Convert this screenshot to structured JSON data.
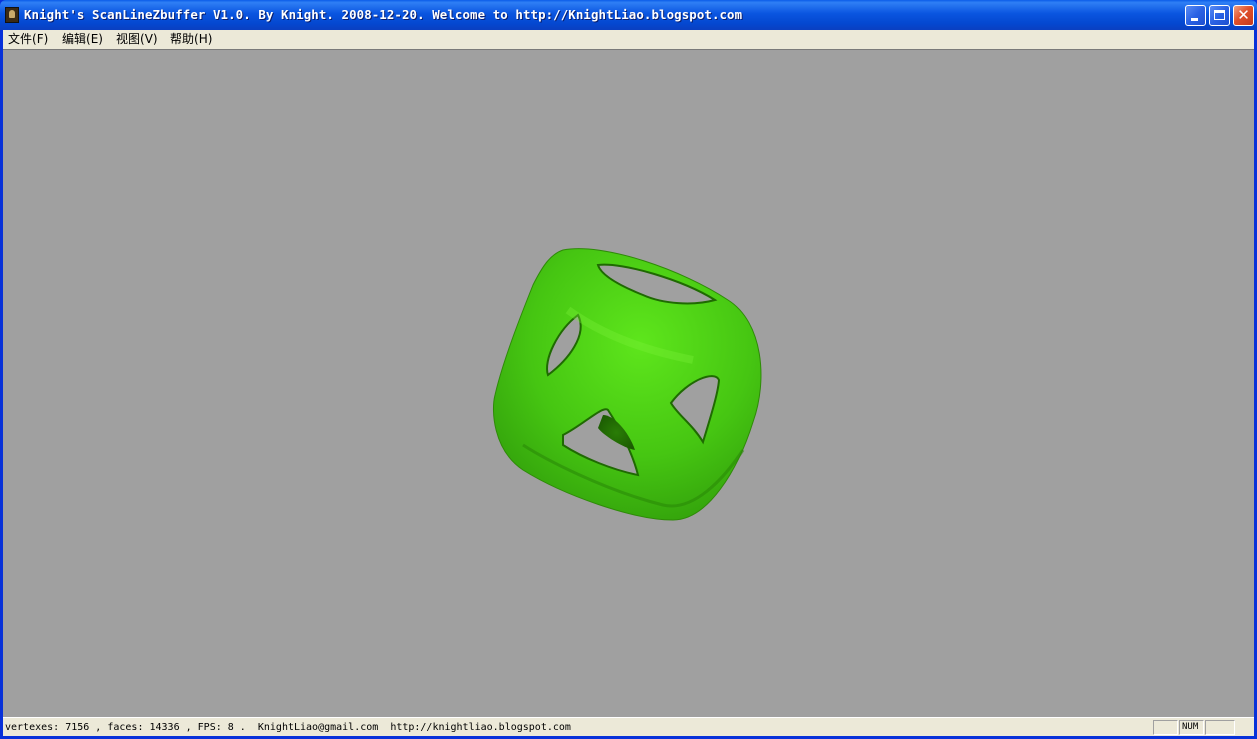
{
  "window": {
    "title": "Knight's ScanLineZbuffer V1.0. By Knight. 2008-12-20.  Welcome to http://KnightLiao.blogspot.com",
    "controls": {
      "close": "✕"
    }
  },
  "menu": {
    "file": {
      "label": "文件",
      "key": "(F)"
    },
    "edit": {
      "label": "编辑",
      "key": "(E)"
    },
    "view": {
      "label": "视图",
      "key": "(V)"
    },
    "help": {
      "label": "帮助",
      "key": "(H)"
    }
  },
  "viewport": {
    "background": "#a0a0a0",
    "model_color": "#4fd214"
  },
  "status": {
    "text": "vertexes: 7156 , faces: 14336 , FPS: 8 .  KnightLiao@gmail.com  http://knightliao.blogspot.com",
    "num_indicator": "NUM"
  }
}
